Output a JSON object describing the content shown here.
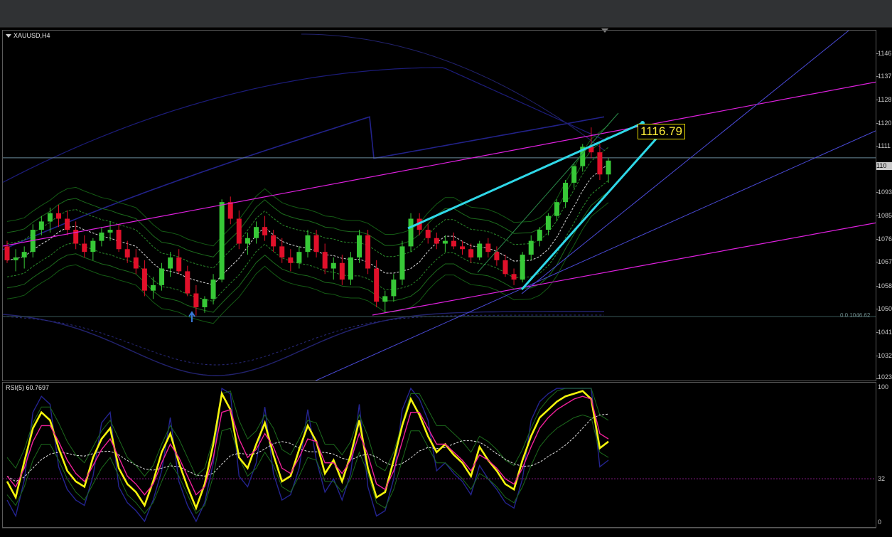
{
  "window": {
    "symbol_title": "XAUUSD,H4",
    "rsi_title": "RSI(5) 60.7697",
    "current_price_label": "110",
    "price_tag": "1116.79",
    "fib_label": "0.0 1046.62"
  },
  "price_axis": {
    "labels": [
      "1146",
      "1137",
      "1128",
      "1120",
      "1111",
      "1093",
      "1085",
      "1076",
      "1067",
      "1058",
      "1050",
      "1041",
      "1032",
      "1023"
    ]
  },
  "rsi_axis": {
    "labels": [
      "100",
      "32",
      "0"
    ]
  },
  "colors": {
    "bull": "#37c837",
    "bear": "#e0102a",
    "trend_cyan": "#2fd8e8",
    "trend_magenta": "#e020e0",
    "channel_blue": "#4848c8",
    "rsi_yellow": "#f4f40c",
    "rsi_pink": "#f0209a",
    "background": "#000000"
  },
  "chart_data": [
    {
      "type": "candlestick",
      "title": "XAUUSD,H4",
      "ylim": [
        1023,
        1150
      ],
      "current_price": 1104,
      "annotations": [
        "1116.79",
        "0.0 1046.62"
      ],
      "ohlc": [
        [
          1072,
          1074,
          1066,
          1067
        ],
        [
          1067,
          1071,
          1063,
          1068
        ],
        [
          1068,
          1072,
          1064,
          1070
        ],
        [
          1070,
          1080,
          1068,
          1078
        ],
        [
          1078,
          1083,
          1076,
          1081
        ],
        [
          1081,
          1086,
          1077,
          1084
        ],
        [
          1084,
          1087,
          1079,
          1082
        ],
        [
          1082,
          1085,
          1076,
          1078
        ],
        [
          1078,
          1081,
          1071,
          1073
        ],
        [
          1073,
          1076,
          1068,
          1070
        ],
        [
          1070,
          1075,
          1067,
          1074
        ],
        [
          1074,
          1079,
          1072,
          1077
        ],
        [
          1077,
          1081,
          1074,
          1078
        ],
        [
          1078,
          1080,
          1070,
          1071
        ],
        [
          1071,
          1074,
          1066,
          1068
        ],
        [
          1068,
          1071,
          1062,
          1064
        ],
        [
          1064,
          1067,
          1054,
          1056
        ],
        [
          1056,
          1061,
          1053,
          1058
        ],
        [
          1058,
          1066,
          1056,
          1064
        ],
        [
          1064,
          1070,
          1061,
          1068
        ],
        [
          1068,
          1071,
          1062,
          1063
        ],
        [
          1063,
          1065,
          1054,
          1055
        ],
        [
          1055,
          1058,
          1047,
          1050
        ],
        [
          1050,
          1054,
          1048,
          1053
        ],
        [
          1053,
          1062,
          1051,
          1060
        ],
        [
          1060,
          1089,
          1059,
          1088
        ],
        [
          1088,
          1090,
          1080,
          1082
        ],
        [
          1082,
          1085,
          1071,
          1073
        ],
        [
          1073,
          1077,
          1069,
          1075
        ],
        [
          1075,
          1081,
          1073,
          1079
        ],
        [
          1079,
          1083,
          1074,
          1076
        ],
        [
          1076,
          1078,
          1070,
          1072
        ],
        [
          1072,
          1075,
          1066,
          1068
        ],
        [
          1068,
          1071,
          1063,
          1066
        ],
        [
          1066,
          1072,
          1064,
          1070
        ],
        [
          1070,
          1078,
          1068,
          1076
        ],
        [
          1076,
          1078,
          1068,
          1070
        ],
        [
          1070,
          1073,
          1062,
          1064
        ],
        [
          1064,
          1068,
          1060,
          1066
        ],
        [
          1066,
          1069,
          1058,
          1060
        ],
        [
          1060,
          1070,
          1058,
          1068
        ],
        [
          1068,
          1078,
          1066,
          1076
        ],
        [
          1076,
          1078,
          1062,
          1064
        ],
        [
          1064,
          1067,
          1050,
          1052
        ],
        [
          1052,
          1056,
          1048,
          1054
        ],
        [
          1054,
          1062,
          1052,
          1060
        ],
        [
          1060,
          1074,
          1058,
          1072
        ],
        [
          1072,
          1084,
          1070,
          1082
        ],
        [
          1082,
          1084,
          1076,
          1078
        ],
        [
          1078,
          1080,
          1073,
          1075
        ],
        [
          1075,
          1077,
          1071,
          1073
        ],
        [
          1073,
          1076,
          1070,
          1074
        ],
        [
          1074,
          1077,
          1071,
          1072
        ],
        [
          1072,
          1074,
          1069,
          1071
        ],
        [
          1071,
          1073,
          1066,
          1068
        ],
        [
          1068,
          1074,
          1067,
          1073
        ],
        [
          1073,
          1075,
          1068,
          1070
        ],
        [
          1070,
          1072,
          1065,
          1067
        ],
        [
          1067,
          1069,
          1061,
          1062
        ],
        [
          1062,
          1064,
          1058,
          1060
        ],
        [
          1060,
          1070,
          1059,
          1069
        ],
        [
          1069,
          1076,
          1067,
          1074
        ],
        [
          1074,
          1079,
          1072,
          1078
        ],
        [
          1078,
          1084,
          1076,
          1083
        ],
        [
          1083,
          1089,
          1081,
          1088
        ],
        [
          1088,
          1096,
          1086,
          1095
        ],
        [
          1095,
          1102,
          1093,
          1101
        ],
        [
          1101,
          1109,
          1099,
          1108
        ],
        [
          1108,
          1115,
          1104,
          1106
        ],
        [
          1106,
          1109,
          1096,
          1098
        ],
        [
          1098,
          1104,
          1095,
          1103
        ]
      ]
    },
    {
      "type": "line",
      "title": "RSI(5) 60.7697",
      "ylim": [
        0,
        100
      ],
      "levels": [
        32
      ],
      "series": [
        {
          "values": [
            30,
            18,
            45,
            70,
            82,
            76,
            55,
            38,
            30,
            26,
            48,
            62,
            70,
            40,
            28,
            22,
            12,
            30,
            52,
            66,
            44,
            26,
            10,
            28,
            58,
            96,
            84,
            48,
            40,
            58,
            74,
            50,
            30,
            34,
            54,
            72,
            60,
            36,
            46,
            30,
            50,
            76,
            40,
            18,
            22,
            46,
            72,
            92,
            80,
            64,
            52,
            58,
            50,
            44,
            34,
            56,
            46,
            38,
            28,
            24,
            46,
            64,
            78,
            84,
            90,
            94,
            96,
            98,
            92,
            55,
            60
          ]
        },
        {
          "values": [
            34,
            26,
            40,
            60,
            72,
            72,
            60,
            46,
            36,
            30,
            42,
            54,
            62,
            48,
            34,
            28,
            20,
            28,
            44,
            58,
            48,
            34,
            20,
            26,
            48,
            82,
            84,
            62,
            48,
            54,
            66,
            56,
            40,
            36,
            48,
            62,
            60,
            44,
            44,
            36,
            46,
            66,
            50,
            28,
            24,
            38,
            60,
            82,
            82,
            70,
            58,
            58,
            52,
            46,
            38,
            50,
            46,
            40,
            32,
            28,
            40,
            56,
            70,
            78,
            84,
            88,
            92,
            94,
            92,
            66,
            62
          ]
        }
      ]
    }
  ]
}
